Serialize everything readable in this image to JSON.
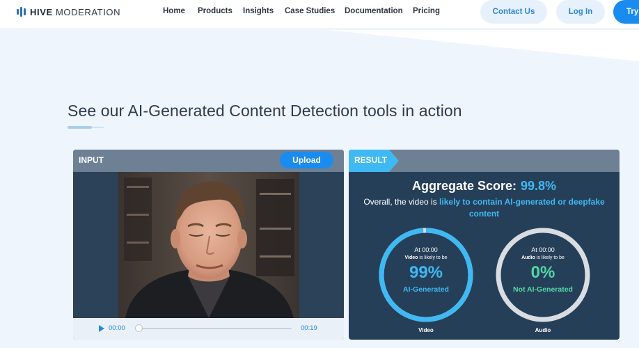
{
  "header": {
    "logo_bold": "HIVE",
    "logo_rest": "MODERATION",
    "nav": [
      "Home",
      "Products",
      "Insights",
      "Case Studies",
      "Documentation",
      "Pricing"
    ],
    "contact_label": "Contact Us",
    "login_label": "Log In",
    "try_label": "Try"
  },
  "section": {
    "title": "See our AI-Generated Content Detection tools in action"
  },
  "input_panel": {
    "label": "INPUT",
    "upload_label": "Upload",
    "player": {
      "current_time": "00:00",
      "total_time": "00:19",
      "progress": 0
    }
  },
  "result_panel": {
    "label": "RESULT",
    "aggregate_label": "Aggregate Score:",
    "aggregate_score": "99.8%",
    "summary_prefix": "Overall, the video is",
    "summary_highlight": "likely to contain AI-generated or deepfake content",
    "gauges": [
      {
        "time": "At 00:00",
        "media": "Video",
        "likely_text": "is likely to be",
        "percent": "99%",
        "value": 0.99,
        "verdict": "AI-Generated",
        "caption": "Video",
        "color": "#3fb9f3"
      },
      {
        "time": "At 00:00",
        "media": "Audio",
        "likely_text": "is likely to be",
        "percent": "0%",
        "value": 0,
        "verdict": "Not AI-Generated",
        "caption": "Audio",
        "color": "#52d6a6"
      }
    ]
  },
  "colors": {
    "accent": "#1a8cf0",
    "panel_bg": "#263f59",
    "panel_header": "#6e8094",
    "highlight": "#3fb9f3",
    "gauge_track": "#d9dde2"
  }
}
